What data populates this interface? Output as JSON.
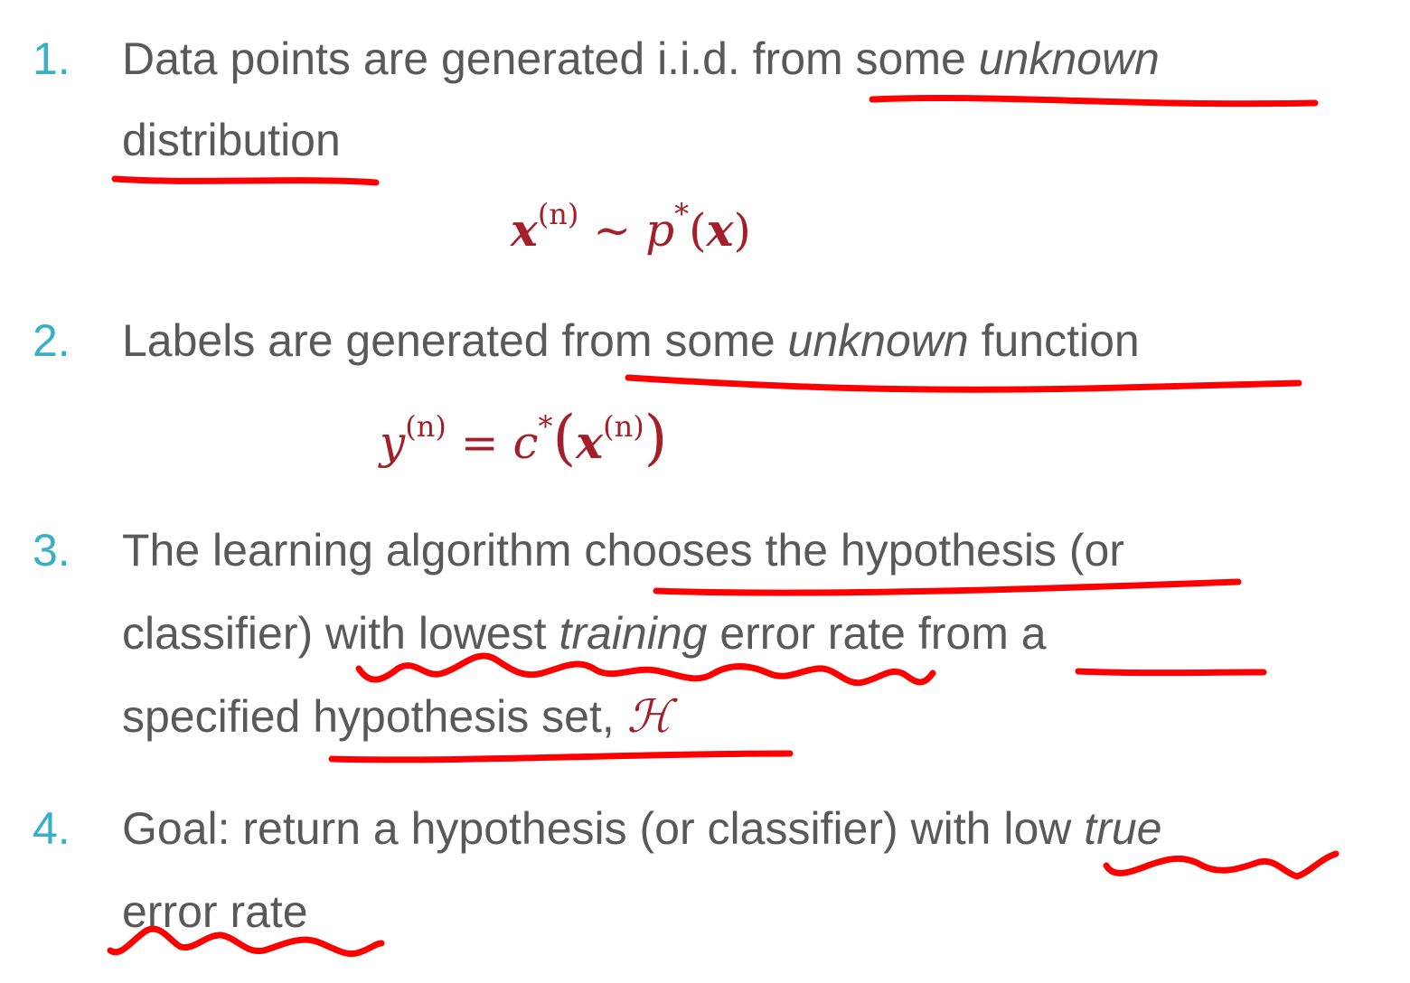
{
  "items": [
    {
      "number": "1.",
      "line1": {
        "pre": "Data points are generated i.i.d. from some ",
        "em": "unknown"
      },
      "line2": "distribution",
      "equation": {
        "lhs_var": "x",
        "lhs_sup": "(n)",
        "rel": " ∼ ",
        "fn": "p",
        "fn_sup": "*",
        "open": "(",
        "arg": "x",
        "close": ")"
      }
    },
    {
      "number": "2.",
      "line1": {
        "pre": "Labels are generated from some ",
        "em": "unknown",
        "post": " function"
      },
      "equation": {
        "lhs_var": "y",
        "lhs_sup": "(n)",
        "rel": " = ",
        "fn": "c",
        "fn_sup": "*",
        "open": "(",
        "arg": "x",
        "arg_sup": "(n)",
        "close": ")"
      }
    },
    {
      "number": "3.",
      "line1": "The learning algorithm chooses the hypothesis (or",
      "line2": {
        "pre": "classifier) with lowest ",
        "em": "training",
        "post": " error rate from a"
      },
      "line3": {
        "pre": "specified hypothesis set, ",
        "symbol": "ℋ"
      }
    },
    {
      "number": "4.",
      "line1": {
        "pre": "Goal: return a hypothesis (or classifier) with low ",
        "em": "true"
      },
      "line2": "error rate"
    }
  ],
  "colors": {
    "number": "#3ab0c8",
    "text": "#595959",
    "math": "#a3202a",
    "ink": "#ff0000"
  }
}
